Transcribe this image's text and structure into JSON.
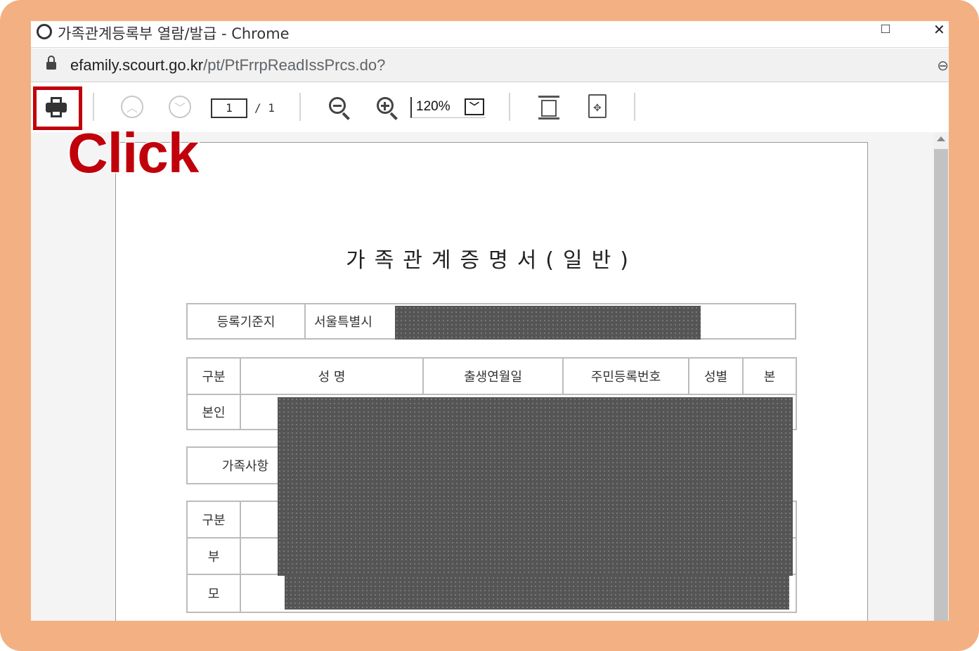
{
  "window": {
    "title": "가족관계등록부 열람/발급 - Chrome",
    "maximize_glyph": "□",
    "close_glyph": "✕"
  },
  "address": {
    "domain": "efamily.scourt.go.kr",
    "path": "/pt/PtFrrpReadIssPrcs.do?"
  },
  "toolbar": {
    "page_current": "1",
    "page_total": "/ 1",
    "zoom": "120%"
  },
  "annotation": {
    "click_label": "Click",
    "highlight_color": "#c0000b"
  },
  "document": {
    "title": "가족관계증명서(일반)",
    "registry_label": "등록기준지",
    "registry_value_visible": "서울특별시 ",
    "headers": [
      "구분",
      "성    명",
      "출생연월일",
      "주민등록번호",
      "성별",
      "본"
    ],
    "self_label": "본인",
    "family_label": "가족사항",
    "family_rows": [
      "구분",
      "부",
      "모"
    ]
  },
  "colors": {
    "frame": "#f3b083",
    "redaction": "#555555"
  }
}
